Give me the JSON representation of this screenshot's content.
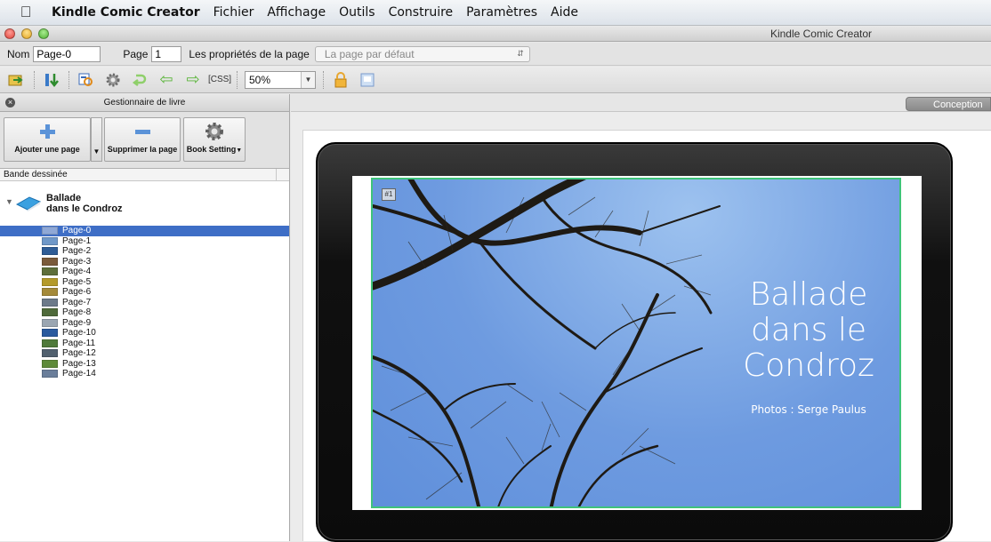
{
  "menubar": {
    "app": "Kindle Comic Creator",
    "items": [
      "Fichier",
      "Affichage",
      "Outils",
      "Construire",
      "Paramètres",
      "Aide"
    ]
  },
  "window": {
    "title": "Kindle Comic Creator"
  },
  "properties": {
    "name_label": "Nom",
    "name_value": "Page-0",
    "page_label": "Page",
    "page_value": "1",
    "props_label": "Les propriétés de la page",
    "props_value": "La page par défaut"
  },
  "toolbar": {
    "zoom_value": "50%",
    "css_label": "CSS"
  },
  "book_manager": {
    "title": "Gestionnaire de livre",
    "add_page": "Ajouter une page",
    "delete_page": "Supprimer la page",
    "book_settings": "Book Setting",
    "column": "Bande dessinée",
    "book_title_line1": "Ballade",
    "book_title_line2": "dans le Condroz",
    "pages": [
      {
        "label": "Page-0",
        "color": "#8fa8d6"
      },
      {
        "label": "Page-1",
        "color": "#6f98c8"
      },
      {
        "label": "Page-2",
        "color": "#2e5c96"
      },
      {
        "label": "Page-3",
        "color": "#7a5a3a"
      },
      {
        "label": "Page-4",
        "color": "#5d6e3a"
      },
      {
        "label": "Page-5",
        "color": "#b49a2a"
      },
      {
        "label": "Page-6",
        "color": "#a48a3a"
      },
      {
        "label": "Page-7",
        "color": "#6c7a8a"
      },
      {
        "label": "Page-8",
        "color": "#4e6a3a"
      },
      {
        "label": "Page-9",
        "color": "#9aa6b2"
      },
      {
        "label": "Page-10",
        "color": "#2a5a9e"
      },
      {
        "label": "Page-11",
        "color": "#4f7a3a"
      },
      {
        "label": "Page-12",
        "color": "#50606e"
      },
      {
        "label": "Page-13",
        "color": "#5e8a3a"
      },
      {
        "label": "Page-14",
        "color": "#6a7e9a"
      }
    ]
  },
  "main": {
    "tab": "Conception",
    "page_badge": "#1",
    "art_title_1": "Ballade",
    "art_title_2": "dans le",
    "art_title_3": "Condroz",
    "art_subtitle": "Photos : Serge Paulus"
  }
}
